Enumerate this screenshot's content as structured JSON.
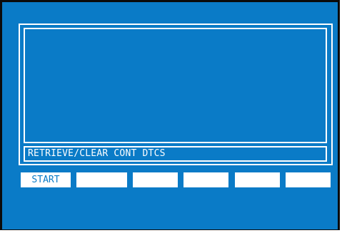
{
  "display": {
    "status_text": "RETRIEVE/CLEAR CONT DTCS"
  },
  "softkeys": [
    {
      "label": "START"
    },
    {
      "label": ""
    },
    {
      "label": ""
    },
    {
      "label": ""
    },
    {
      "label": ""
    },
    {
      "label": ""
    }
  ],
  "colors": {
    "screen_background": "#0a7bc7",
    "bezel": "#0b0b0b",
    "foreground": "#ffffff"
  }
}
